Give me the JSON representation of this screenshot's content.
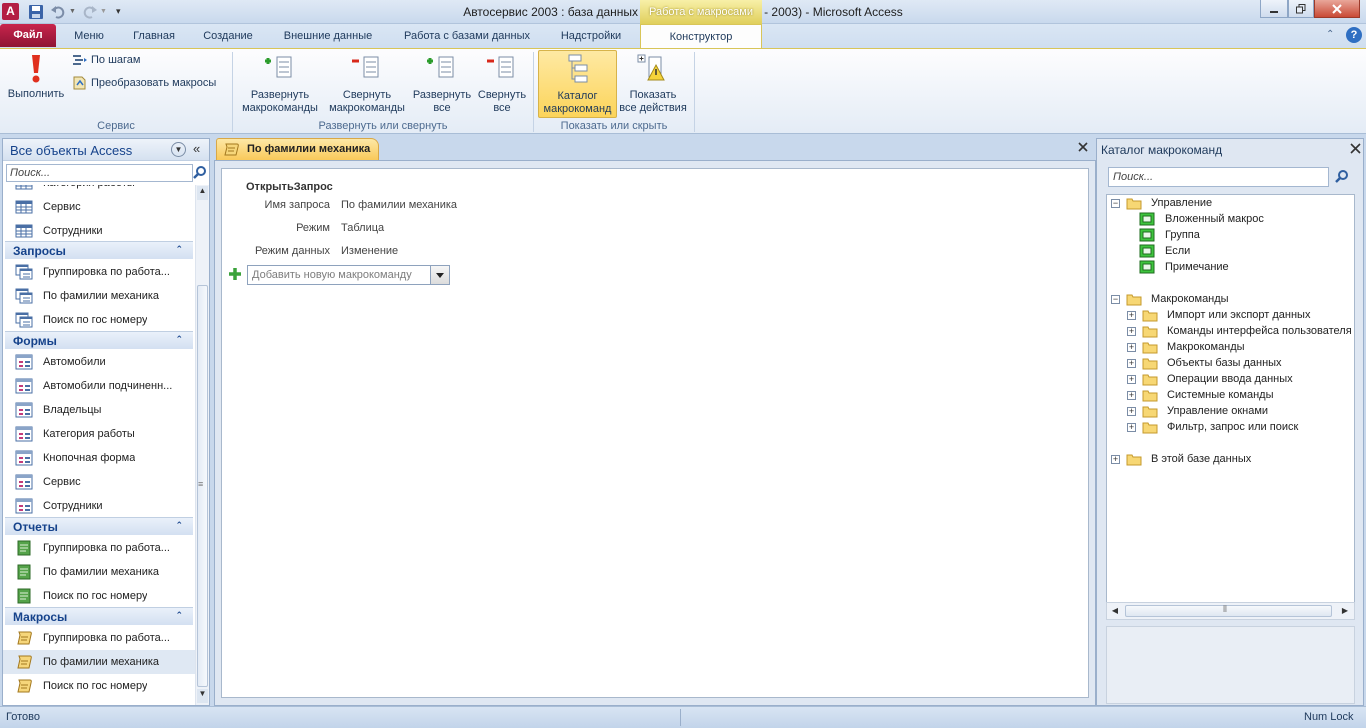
{
  "window": {
    "title": "Автосервис 2003 : база данных (формат Access 2002 - 2003)  -  Microsoft Access",
    "context_tab": "Работа с макросами"
  },
  "tabs": [
    "Файл",
    "Меню",
    "Главная",
    "Создание",
    "Внешние данные",
    "Работа с базами данных",
    "Надстройки",
    "Конструктор"
  ],
  "ribbon": {
    "run_label": "Выполнить",
    "step_label": "По шагам",
    "convert_label": "Преобразовать макросы",
    "group_service": "Сервис",
    "expand_actions": [
      "Развернуть",
      "макрокоманды"
    ],
    "collapse_actions": [
      "Свернуть",
      "макрокоманды"
    ],
    "expand_all": [
      "Развернуть",
      "все"
    ],
    "collapse_all": [
      "Свернуть",
      "все"
    ],
    "group_expand_collapse": "Развернуть или свернуть",
    "action_catalog": [
      "Каталог",
      "макрокоманд"
    ],
    "show_all_actions": [
      "Показать",
      "все действия"
    ],
    "group_show_hide": "Показать или скрыть"
  },
  "nav": {
    "title": "Все объекты Access",
    "search_placeholder": "Поиск...",
    "partial_top": "Категория работы",
    "top_items": [
      "Сервис",
      "Сотрудники"
    ],
    "groups": [
      {
        "label": "Запросы",
        "items": [
          "Группировка по работа...",
          "По фамилии механика",
          "Поиск по гос номеру"
        ]
      },
      {
        "label": "Формы",
        "items": [
          "Автомобили",
          "Автомобили подчиненн...",
          "Владельцы",
          "Категория работы",
          "Кнопочная форма",
          "Сервис",
          "Сотрудники"
        ]
      },
      {
        "label": "Отчеты",
        "items": [
          "Группировка по работа...",
          "По фамилии механика",
          "Поиск по гос номеру"
        ]
      },
      {
        "label": "Макросы",
        "items": [
          "Группировка по работа...",
          "По фамилии механика",
          "Поиск по гос номеру"
        ]
      }
    ]
  },
  "document": {
    "tab_label": "По фамилии механика",
    "action_name": "ОткрытьЗапрос",
    "args": [
      {
        "name": "Имя запроса",
        "value": "По фамилии механика"
      },
      {
        "name": "Режим",
        "value": "Таблица"
      },
      {
        "name": "Режим данных",
        "value": "Изменение"
      }
    ],
    "add_action_placeholder": "Добавить новую макрокоманду"
  },
  "catalog": {
    "title": "Каталог макрокоманд",
    "search_placeholder": "Поиск...",
    "flow_label": "Управление",
    "flow_items": [
      "Вложенный макрос",
      "Группа",
      "Если",
      "Примечание"
    ],
    "actions_label": "Макрокоманды",
    "action_folders": [
      "Импорт или экспорт данных",
      "Команды интерфейса пользователя",
      "Макрокоманды",
      "Объекты базы данных",
      "Операции ввода данных",
      "Системные команды",
      "Управление окнами",
      "Фильтр, запрос или поиск"
    ],
    "db_label": "В этой базе данных"
  },
  "status": {
    "left": "Готово",
    "right": "Num Lock"
  },
  "colors": {
    "file_tab": "#b31e44",
    "context_tab": "#e6d36a",
    "doc_tab": "#f9c95a"
  }
}
